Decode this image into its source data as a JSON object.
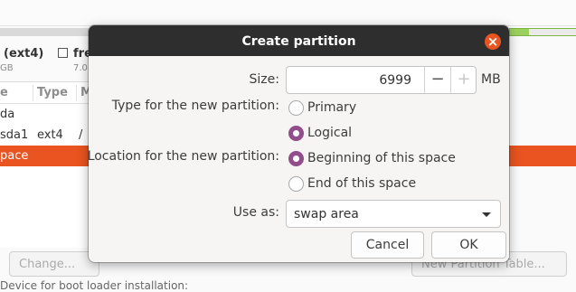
{
  "background": {
    "partition_legend": {
      "label": "(ext4)",
      "size": "GB"
    },
    "free_legend": {
      "label": "fre",
      "size": "7.0"
    },
    "table": {
      "headers": [
        "e",
        "Type",
        "M"
      ],
      "rows": [
        {
          "device": "da",
          "type": "",
          "mount": "",
          "selected": false
        },
        {
          "device": "sda1",
          "type": "ext4",
          "mount": "/",
          "selected": false
        },
        {
          "device": "pace",
          "type": "",
          "mount": "",
          "selected": true
        }
      ]
    },
    "buttons": {
      "change": "Change...",
      "new_partition_table": "New Partition Table..."
    },
    "bottom_text": "Device for boot loader installation:"
  },
  "dialog": {
    "title": "Create partition",
    "close_icon": "close-icon",
    "size": {
      "label": "Size:",
      "value": "6999",
      "minus": "−",
      "plus": "+",
      "unit": "MB"
    },
    "type": {
      "label": "Type for the new partition:",
      "options": [
        {
          "label": "Primary",
          "selected": false
        },
        {
          "label": "Logical",
          "selected": true
        }
      ]
    },
    "location": {
      "label": "Location for the new partition:",
      "options": [
        {
          "label": "Beginning of this space",
          "selected": true
        },
        {
          "label": "End of this space",
          "selected": false
        }
      ]
    },
    "use_as": {
      "label": "Use as:",
      "value": "swap area"
    },
    "buttons": {
      "cancel": "Cancel",
      "ok": "OK"
    },
    "colors": {
      "titlebar": "#2e2e2e",
      "close": "#e95420",
      "radio_selected": "#924d8b",
      "selection": "#e95420"
    }
  }
}
